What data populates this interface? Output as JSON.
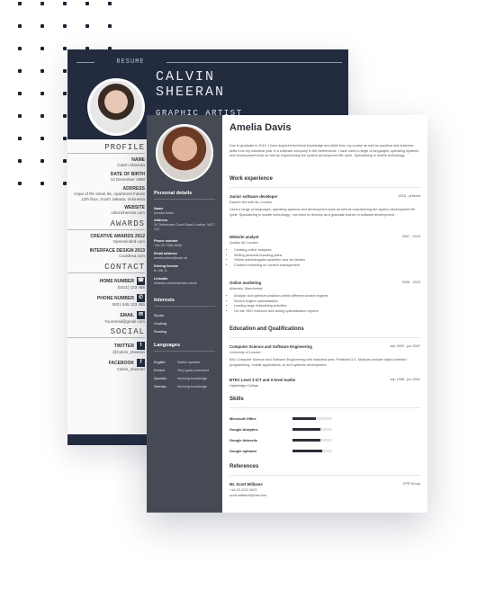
{
  "back_resume": {
    "resume_label": "RESUME",
    "name_first": "CALVIN",
    "name_last": "SHEERAN",
    "job_title": "GRAPHIC ARTIST",
    "profile_heading": "PROFILE",
    "name_label": "NAME",
    "name_value": "Calvin Sheeran",
    "dob_label": "DATE OF BIRTH",
    "dob_value": "12 December 1990",
    "address_label": "ADDRESS",
    "address_value": "Hope of life street 56, Apartment Future 12th floor, South Jakarta, Indonesia",
    "website_label": "WEBSITE",
    "website_value": "calvinsheeran.com",
    "awards_heading": "AWARDS",
    "award1_label": "CREATIVE AWARDS 2012",
    "award1_value": "Openminded.com",
    "award2_label": "INTERFACE DESIGN 2013",
    "award2_value": "Cooldesa.com",
    "contact_heading": "CONTACT",
    "home_label": "HOME NUMBER",
    "home_value": "(0411) 123 456",
    "phone_label": "PHONE NUMBER",
    "phone_value": "0821 945 123 456",
    "email_label": "EMAIL",
    "email_value": "Youremail@gmail.com",
    "social_heading": "SOCIAL",
    "twitter_label": "TWITTER",
    "twitter_value": "@Calvin_sheeran",
    "facebook_label": "FACEBOOK",
    "facebook_value": "Calvin_sheeran"
  },
  "front_resume": {
    "name": "Amelia Davis",
    "intro": "Due to graduate in 2014, I have acquired technical knowledge and skills from my course as well as practical and business skills from my industrial year in a software company in the Netherlands. I have used a range of languages, operating systems and development tools as well as experiencing the system development life cycle. Specializing in mobile technology.",
    "sidebar": {
      "personal_heading": "Personal details",
      "name_label": "Name",
      "name_value": "Amelia Davis",
      "address_label": "Address",
      "address_value": "24 Tottenham Court Road London, W1T 1JY",
      "phone_label": "Phone number",
      "phone_value": "+44 20 7946 0636",
      "email_label": "Email address",
      "email_value": "amelia.davis@mail.uk",
      "license_label": "Driving license",
      "license_value": "B, AM, A",
      "linkedin_label": "LinkedIn",
      "linkedin_value": "linkedin.com/in/amelia-davis",
      "interests_heading": "Interests",
      "interests": [
        "Sports",
        "Cooking",
        "Reading"
      ],
      "languages_heading": "Languages",
      "languages": [
        {
          "name": "English",
          "level": "Native speaker"
        },
        {
          "name": "French",
          "level": "Very good command"
        },
        {
          "name": "Spanish",
          "level": "Working knowledge"
        },
        {
          "name": "German",
          "level": "Working knowledge"
        }
      ]
    },
    "work_heading": "Work experience",
    "jobs": [
      {
        "title": "Junior software developer",
        "date": "2015 - present",
        "company": "Explore the web ltd, London",
        "description": "Used a range of languages, operating systems and development tools as well as experiencing the system development life cycle. Specializing in mobile technology, I am keen to develop as a graduate trainee in software development."
      },
      {
        "title": "Website analyst",
        "date": "2007 - 2015",
        "company": "Quality ltd, London",
        "bullets": [
          "Creating online analyses",
          "Writing personal branding plans",
          "Online marketingplan opstellen voor de klanten",
          "Content marketing en content management"
        ]
      },
      {
        "title": "Online marketing",
        "date": "2005 - 2015",
        "company": "Adverbiz, Manchester",
        "bullets": [
          "Analyse and optimize positions within different search engines",
          "Search engine optimalisation",
          "Leading large linkbuilding activities",
          "On site SEO research and writing optimalisation reports"
        ]
      }
    ],
    "education_heading": "Education and Qualifications",
    "education": [
      {
        "title": "Computer Science and Software Engineering",
        "date": "sep 2002 - jun 2007",
        "school": "University of London",
        "description": "BSc Computer Science and Software Engineering with industrial year. Predicted 2:1. Modules include object-oriented programming, mobile applications, AI and systems development."
      },
      {
        "title": "BTEC Level 3 ICT and A-level maths",
        "date": "sep 1998 - jun 2002",
        "school": "Highbridge College"
      }
    ],
    "skills_heading": "Skills",
    "skills": [
      {
        "name": "Microsoft Office",
        "level": 0.6
      },
      {
        "name": "Google Analytics",
        "level": 0.7
      },
      {
        "name": "Google Adwords",
        "level": 0.7
      },
      {
        "name": "Google optimize",
        "level": 0.75
      }
    ],
    "references_heading": "References",
    "reference": {
      "name": "Mr. Scott Williams",
      "company": "CPE Group",
      "phone": "+44 20 1212 4821",
      "email": "scott.williams@mail.com"
    }
  }
}
